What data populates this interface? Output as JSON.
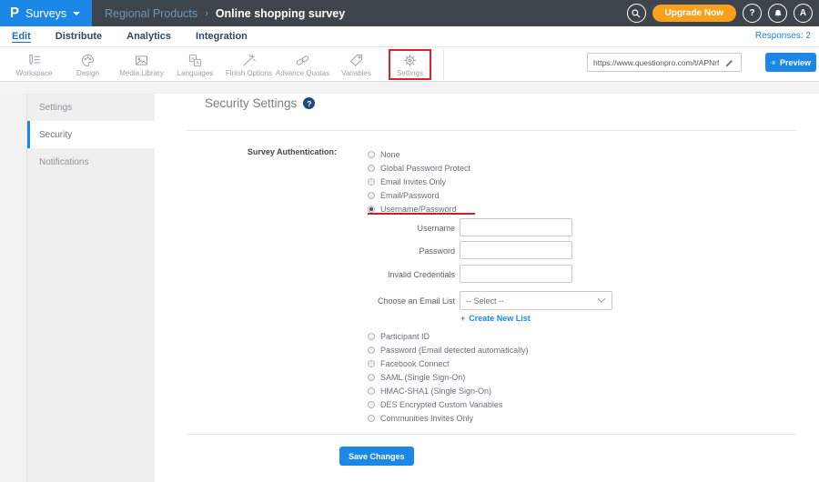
{
  "topbar": {
    "logo_letter": "P",
    "surveys_label": "Surveys",
    "breadcrumb": {
      "parent": "Regional Products",
      "separator": "›",
      "current": "Online shopping survey"
    },
    "upgrade_label": "Upgrade Now",
    "help_label": "?",
    "avatar_label": "A"
  },
  "nav": {
    "tabs": [
      "Edit",
      "Distribute",
      "Analytics",
      "Integration"
    ],
    "active_tab": "Edit",
    "responses_label": "Responses: 2"
  },
  "toolbar": {
    "items": [
      "Workspace",
      "Design",
      "Media Library",
      "Languages",
      "Finish Options",
      "Advance Quotas",
      "Variables",
      "Settings"
    ],
    "highlighted_item": "Settings",
    "url_value": "https://www.questionpro.com/t/APNrfZ",
    "preview_label": "Preview"
  },
  "sidebar": {
    "items": [
      "Settings",
      "Security",
      "Notifications"
    ],
    "active_item": "Security"
  },
  "main": {
    "heading": "Security Settings",
    "help_badge": "?",
    "auth_label": "Survey Authentication:",
    "auth_options_top": [
      "None",
      "Global Password Protect",
      "Email Invites Only",
      "Email/Password",
      "Username/Password"
    ],
    "selected_option": "Username/Password",
    "fields": {
      "username_label": "Username",
      "password_label": "Password",
      "invalid_label": "Invalid Credentials",
      "email_list_label": "Choose an Email List",
      "email_list_value": "-- Select --",
      "create_plus": "+",
      "create_new_list": "Create New List"
    },
    "auth_options_bottom": [
      "Participant ID",
      "Password (Email detected automatically)",
      "Facebook Connect",
      "SAML (Single Sign-On)",
      "HMAC-SHA1 (Single Sign-On)",
      "DES Encrypted Custom Variables",
      "Communities Invites Only"
    ],
    "save_label": "Save Changes"
  },
  "colors": {
    "accent_blue": "#1b87e6",
    "topbar_bg": "#3d444c",
    "upgrade_orange": "#f9a11f",
    "annotation_red": "#d8252b",
    "sidebar_bg": "#efeff0"
  }
}
